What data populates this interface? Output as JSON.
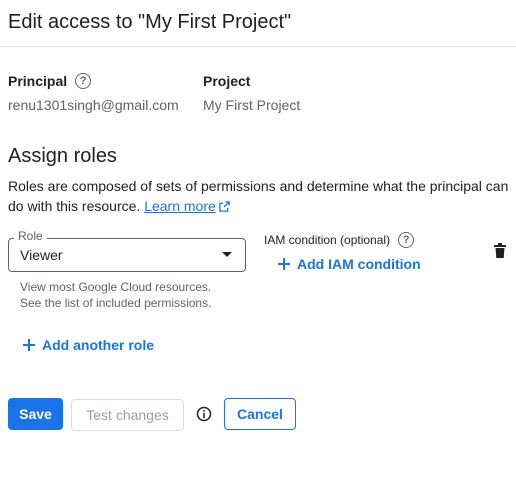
{
  "dialog": {
    "title": "Edit access to \"My First Project\""
  },
  "principal": {
    "label": "Principal",
    "value": "renu1301singh@gmail.com"
  },
  "project": {
    "label": "Project",
    "value": "My First Project"
  },
  "assign_roles": {
    "title": "Assign roles",
    "description": "Roles are composed of sets of permissions and determine what the principal can do with this resource.",
    "learn_more": "Learn more"
  },
  "role": {
    "label": "Role",
    "value": "Viewer",
    "help_line1": "View most Google Cloud resources.",
    "help_line2": "See the list of included permissions."
  },
  "iam_condition": {
    "label": "IAM condition (optional)",
    "add_label": "Add IAM condition"
  },
  "add_another_role": "Add another role",
  "actions": {
    "save": "Save",
    "test_changes": "Test changes",
    "cancel": "Cancel"
  },
  "icons": {
    "help": "help-circle-icon",
    "external_link": "external-link-icon",
    "dropdown": "arrow-drop-down-icon",
    "plus": "plus-icon",
    "delete": "trash-icon",
    "info": "info-icon"
  },
  "colors": {
    "accent": "#1a73e8",
    "text": "#202124",
    "secondary_text": "#5f6368",
    "disabled_text": "#9aa0a6"
  }
}
